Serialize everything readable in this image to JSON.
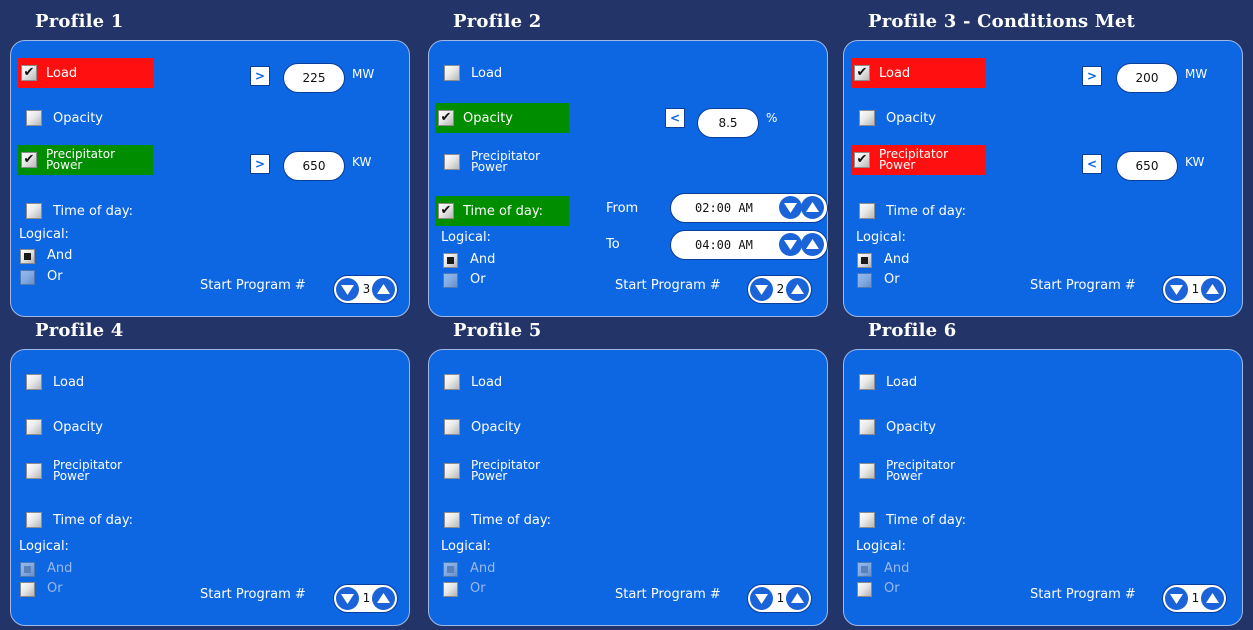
{
  "profiles": [
    {
      "title": "Profile 1",
      "conditions": {
        "load": {
          "label": "Load",
          "checked": true,
          "highlight": "red",
          "operator": ">",
          "value": "225",
          "unit": "MW"
        },
        "opacity": {
          "label": "Opacity",
          "checked": false,
          "highlight": "none"
        },
        "precip": {
          "label_line1": "Precipitator",
          "label_line2": "Power",
          "checked": true,
          "highlight": "green",
          "operator": ">",
          "value": "650",
          "unit": "KW"
        },
        "time": {
          "label": "Time of day:",
          "checked": false,
          "highlight": "none"
        }
      },
      "logical": {
        "label": "Logical:",
        "and_label": "And",
        "or_label": "Or",
        "selected": "and"
      },
      "start_program": {
        "label": "Start Program #",
        "value": "3"
      }
    },
    {
      "title": "Profile 2",
      "conditions": {
        "load": {
          "label": "Load",
          "checked": false,
          "highlight": "none"
        },
        "opacity": {
          "label": "Opacity",
          "checked": true,
          "highlight": "green",
          "operator": "<",
          "value": "8.5",
          "unit": "%"
        },
        "precip": {
          "label_line1": "Precipitator",
          "label_line2": "Power",
          "checked": false,
          "highlight": "none"
        },
        "time": {
          "label": "Time of day:",
          "checked": true,
          "highlight": "green",
          "from_label": "From",
          "from_value": "02:00 AM",
          "to_label": "To",
          "to_value": "04:00 AM"
        }
      },
      "logical": {
        "label": "Logical:",
        "and_label": "And",
        "or_label": "Or",
        "selected": "and"
      },
      "start_program": {
        "label": "Start Program #",
        "value": "2"
      }
    },
    {
      "title": "Profile 3 - Conditions Met",
      "conditions": {
        "load": {
          "label": "Load",
          "checked": true,
          "highlight": "red",
          "operator": ">",
          "value": "200",
          "unit": "MW"
        },
        "opacity": {
          "label": "Opacity",
          "checked": false,
          "highlight": "none"
        },
        "precip": {
          "label_line1": "Precipitator",
          "label_line2": "Power",
          "checked": true,
          "highlight": "red",
          "operator": "<",
          "value": "650",
          "unit": "KW"
        },
        "time": {
          "label": "Time of day:",
          "checked": false,
          "highlight": "none"
        }
      },
      "logical": {
        "label": "Logical:",
        "and_label": "And",
        "or_label": "Or",
        "selected": "and"
      },
      "start_program": {
        "label": "Start Program #",
        "value": "1"
      }
    },
    {
      "title": "Profile 4",
      "conditions": {
        "load": {
          "label": "Load",
          "checked": false,
          "highlight": "none"
        },
        "opacity": {
          "label": "Opacity",
          "checked": false,
          "highlight": "none"
        },
        "precip": {
          "label_line1": "Precipitator",
          "label_line2": "Power",
          "checked": false,
          "highlight": "none"
        },
        "time": {
          "label": "Time of day:",
          "checked": false,
          "highlight": "none"
        }
      },
      "logical": {
        "label": "Logical:",
        "and_label": "And",
        "or_label": "Or",
        "selected": "and",
        "disabled": true
      },
      "start_program": {
        "label": "Start Program #",
        "value": "1"
      }
    },
    {
      "title": "Profile 5",
      "conditions": {
        "load": {
          "label": "Load",
          "checked": false,
          "highlight": "none"
        },
        "opacity": {
          "label": "Opacity",
          "checked": false,
          "highlight": "none"
        },
        "precip": {
          "label_line1": "Precipitator",
          "label_line2": "Power",
          "checked": false,
          "highlight": "none"
        },
        "time": {
          "label": "Time of day:",
          "checked": false,
          "highlight": "none"
        }
      },
      "logical": {
        "label": "Logical:",
        "and_label": "And",
        "or_label": "Or",
        "selected": "and",
        "disabled": true
      },
      "start_program": {
        "label": "Start Program #",
        "value": "1"
      }
    },
    {
      "title": "Profile 6",
      "conditions": {
        "load": {
          "label": "Load",
          "checked": false,
          "highlight": "none"
        },
        "opacity": {
          "label": "Opacity",
          "checked": false,
          "highlight": "none"
        },
        "precip": {
          "label_line1": "Precipitator",
          "label_line2": "Power",
          "checked": false,
          "highlight": "none"
        },
        "time": {
          "label": "Time of day:",
          "checked": false,
          "highlight": "none"
        }
      },
      "logical": {
        "label": "Logical:",
        "and_label": "And",
        "or_label": "Or",
        "selected": "and",
        "disabled": true
      },
      "start_program": {
        "label": "Start Program #",
        "value": "1"
      }
    }
  ],
  "colors": {
    "background": "#233568",
    "panel": "#0d66e2",
    "highlight_red": "#ff0f0f",
    "highlight_green": "#008d00",
    "spinner_button": "#1a63d8"
  },
  "icons": {
    "check": "checkmark-icon",
    "spin_down": "arrow-down-icon",
    "spin_up": "arrow-up-icon"
  }
}
